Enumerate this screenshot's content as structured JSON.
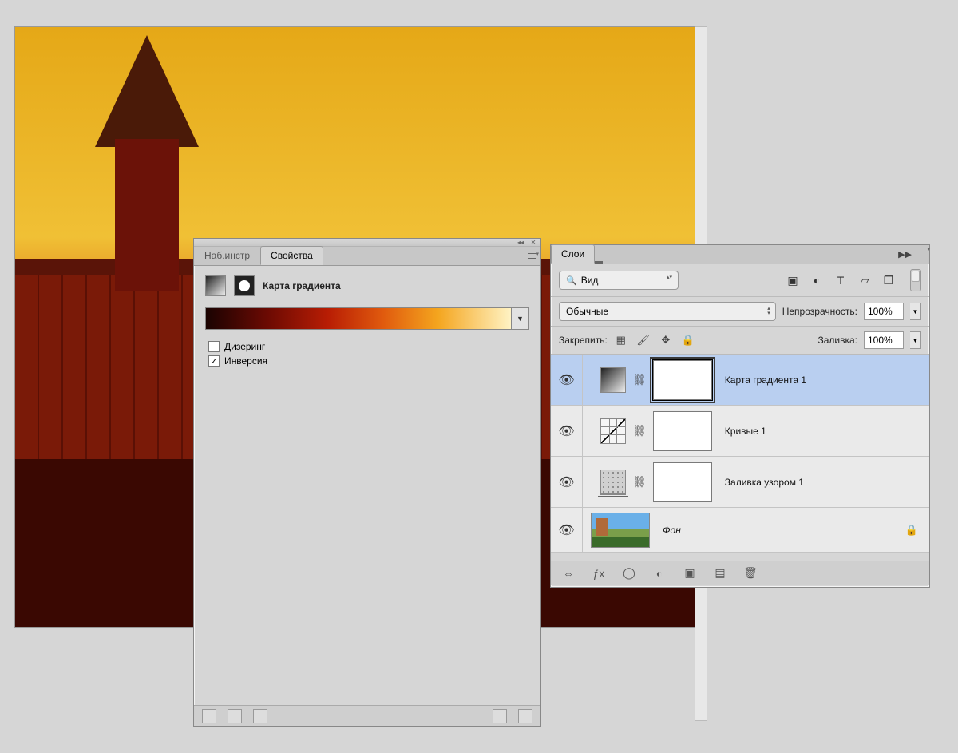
{
  "properties_panel": {
    "tabs": {
      "tools": "Наб.инстр",
      "properties": "Свойства"
    },
    "title": "Карта градиента",
    "dither": {
      "label": "Дизеринг",
      "checked": false
    },
    "invert": {
      "label": "Инверсия",
      "checked": true
    }
  },
  "layers_panel": {
    "tab": "Слои",
    "search_mode": "Вид",
    "blend_mode": "Обычные",
    "opacity": {
      "label": "Непрозрачность:",
      "value": "100%"
    },
    "lock_label": "Закрепить:",
    "fill": {
      "label": "Заливка:",
      "value": "100%"
    },
    "layers": [
      {
        "name": "Карта градиента 1",
        "type": "gradient-map",
        "selected": true
      },
      {
        "name": "Кривые 1",
        "type": "curves",
        "selected": false
      },
      {
        "name": "Заливка узором 1",
        "type": "pattern",
        "selected": false
      },
      {
        "name": "Фон",
        "type": "background",
        "locked": true
      }
    ]
  }
}
